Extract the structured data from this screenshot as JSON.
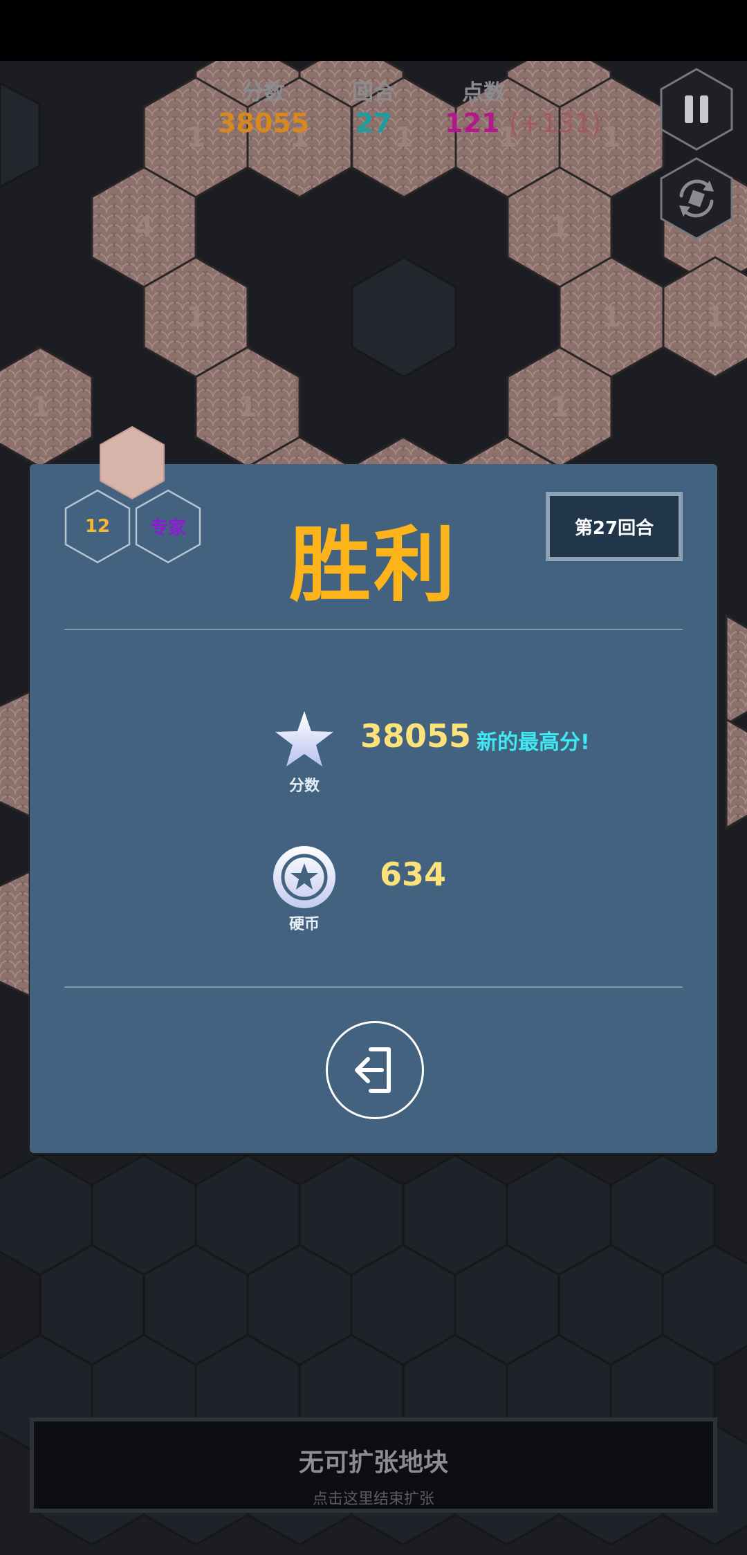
{
  "hud": {
    "score_label": "分数",
    "score_value": "38055",
    "round_label": "回合",
    "round_value": "27",
    "points_label": "点数",
    "points_value": "121",
    "points_bonus": "(+131)"
  },
  "tiles": {
    "labels": [
      "1",
      "1",
      "1",
      "1",
      "1",
      "4",
      "1",
      "1",
      "1",
      "1",
      "1",
      "1",
      "1"
    ]
  },
  "result": {
    "title": "胜利",
    "round_badge": "第27回合",
    "level_badge": "12",
    "difficulty_badge": "专家",
    "score_label": "分数",
    "score_value": "38055",
    "new_best_text": "新的最高分!",
    "coins_label": "硬币",
    "coins_value": "634"
  },
  "footer": {
    "title": "无可扩张地块",
    "subtitle": "点击这里结束扩张"
  },
  "colors": {
    "score": "#d7891f",
    "round": "#1b9ea0",
    "points": "#b2188a",
    "bonus": "#a35a5d",
    "title": "#fdb41b",
    "panel": "#43627f",
    "new_best": "#3ee9f3"
  },
  "icons": {
    "pause": "pause-icon",
    "shuffle": "rotate-icon",
    "score": "star-icon",
    "coins": "coin-star-icon",
    "exit": "exit-icon"
  }
}
